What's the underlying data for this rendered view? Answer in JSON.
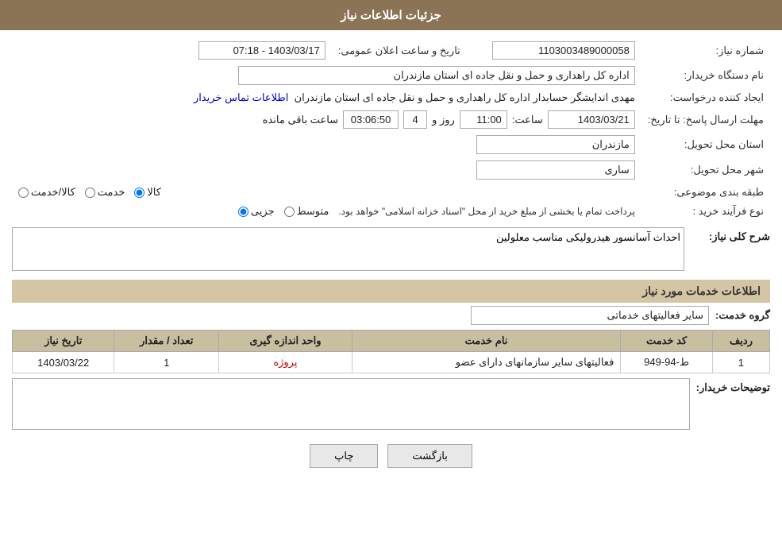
{
  "header": {
    "title": "جزئيات اطلاعات نياز"
  },
  "fields": {
    "need_number_label": "شماره نياز:",
    "need_number_value": "1103003489000058",
    "announcement_date_label": "تاريخ و ساعت اعلان عمومی:",
    "announcement_date_value": "1403/03/17 - 07:18",
    "buyer_org_label": "نام دستگاه خريدار:",
    "buyer_org_value": "اداره کل راهداری و حمل و نقل جاده ای استان مازندران",
    "creator_label": "ايجاد کننده درخواست:",
    "creator_value": "مهدی اندايشگر حسابدار اداره کل راهداری و حمل و نقل جاده ای استان مازندران",
    "contact_info_link": "اطلاعات تماس خريدار",
    "deadline_label": "مهلت ارسال پاسخ: تا تاريخ:",
    "deadline_date": "1403/03/21",
    "deadline_time_label": "ساعت:",
    "deadline_time": "11:00",
    "deadline_day_label": "روز و",
    "deadline_days": "4",
    "deadline_remaining_label": "ساعت باقی مانده",
    "deadline_remaining": "03:06:50",
    "delivery_province_label": "استان محل تحويل:",
    "delivery_province_value": "مازندران",
    "delivery_city_label": "شهر محل تحويل:",
    "delivery_city_value": "ساری",
    "category_label": "طبقه بندی موضوعی:",
    "category_goods": "کالا",
    "category_service": "خدمت",
    "category_goods_service": "کالا/خدمت",
    "purchase_type_label": "نوع فرآيند خريد :",
    "purchase_type_partial": "جزيی",
    "purchase_type_medium": "متوسط",
    "purchase_type_note": "پرداخت تمام يا بخشی از مبلغ خريد از محل \"اسناد خزانه اسلامی\" خواهد بود.",
    "need_description_label": "شرح کلی نياز:",
    "need_description_value": "احداث آسانسور هيدروليکی مناسب معلولين",
    "services_section_label": "اطلاعات خدمات مورد نياز",
    "service_group_label": "گروه خدمت:",
    "service_group_value": "ساير فعاليتهای خدماتی",
    "table_headers": {
      "row_num": "رديف",
      "service_code": "کد خدمت",
      "service_name": "نام خدمت",
      "unit": "واحد اندازه گيری",
      "quantity": "تعداد / مقدار",
      "date": "تاريخ نياز"
    },
    "table_rows": [
      {
        "row_num": "1",
        "service_code": "ط-94-949",
        "service_name": "فعاليتهای ساير سازمانهای دارای عضو",
        "unit": "پروژه",
        "quantity": "1",
        "date": "1403/03/22"
      }
    ],
    "buyer_notes_label": "توضيحات خريدار:"
  },
  "buttons": {
    "print_label": "چاپ",
    "back_label": "بازگشت"
  }
}
